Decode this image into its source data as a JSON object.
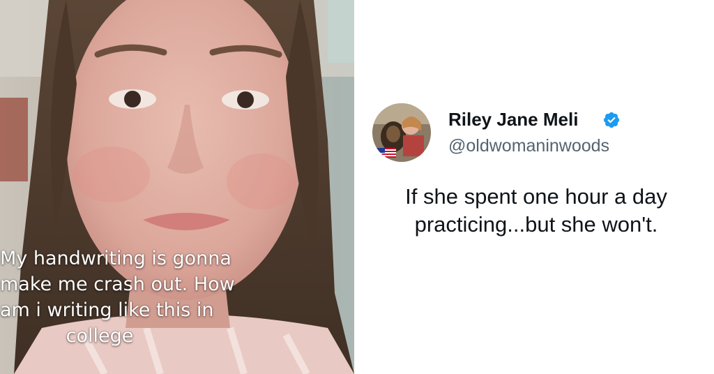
{
  "photo": {
    "caption_lines": [
      "My handwriting is gonna",
      "make me crash out. How",
      "am i writing like this in",
      "college"
    ]
  },
  "tweet": {
    "display_name": "Riley Jane Meli",
    "handle": "@oldwomaninwoods",
    "text": "If she spent one hour a day practicing...but she won't.",
    "verified_icon": "verified-badge-icon"
  },
  "colors": {
    "verified_blue": "#1d9bf0",
    "name_text": "#0f1419",
    "handle_text": "#536471",
    "caption_text": "#ffffff"
  }
}
